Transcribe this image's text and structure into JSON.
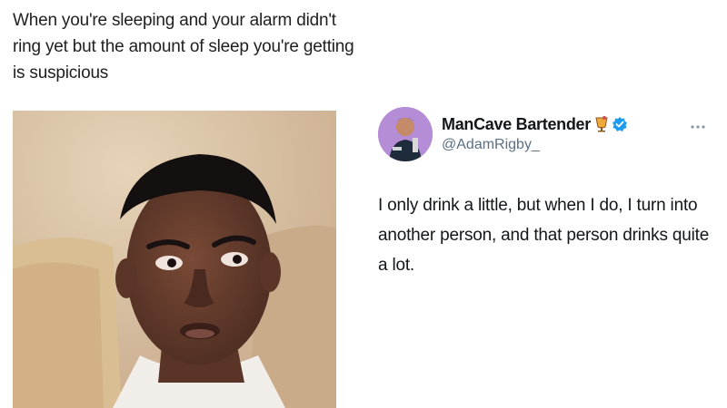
{
  "meme": {
    "caption": "When you're sleeping and your alarm didn't ring yet but the amount of sleep you're getting is suspicious"
  },
  "tweet": {
    "display_name": "ManCave Bartender",
    "handle": "@AdamRigby_",
    "text": "I only drink a little, but when I do, I turn into another person, and that person drinks quite a lot.",
    "icons": [
      "drink-icon",
      "verified-icon",
      "more-icon"
    ]
  },
  "colors": {
    "caption_text": "#1f1f1f",
    "tweet_text": "#14171a",
    "handle_text": "#5b7083",
    "verified_blue": "#1d9bf0",
    "avatar_bg": "#b58cd6"
  }
}
